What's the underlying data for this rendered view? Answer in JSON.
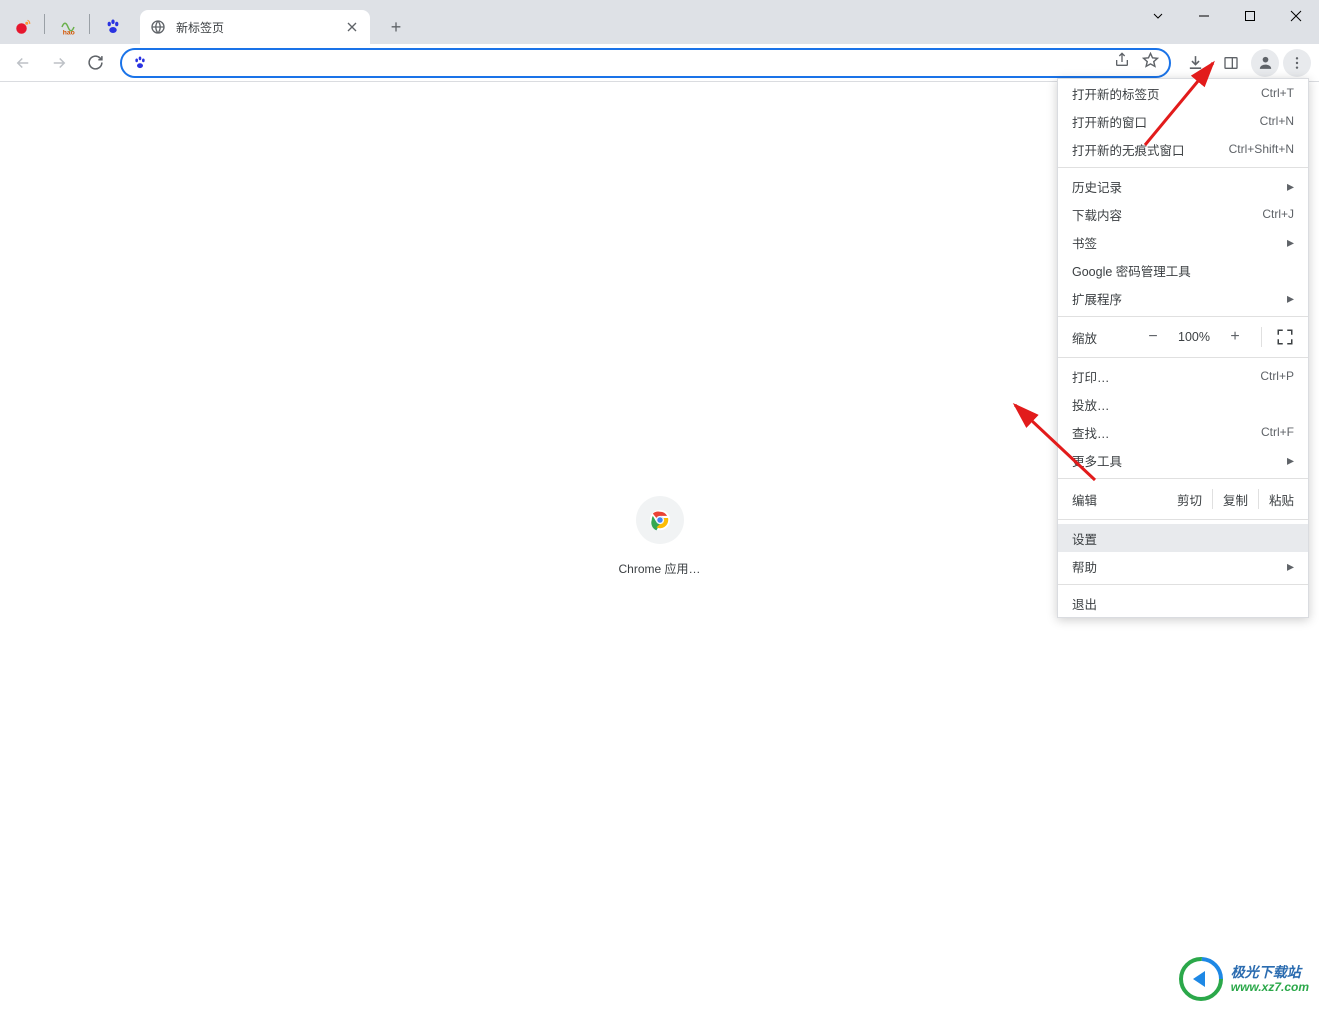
{
  "tab": {
    "title": "新标签页"
  },
  "content": {
    "shortcut_label": "Chrome 应用…"
  },
  "menu": {
    "new_tab": {
      "label": "打开新的标签页",
      "shortcut": "Ctrl+T"
    },
    "new_window": {
      "label": "打开新的窗口",
      "shortcut": "Ctrl+N"
    },
    "incognito": {
      "label": "打开新的无痕式窗口",
      "shortcut": "Ctrl+Shift+N"
    },
    "history": {
      "label": "历史记录"
    },
    "downloads": {
      "label": "下载内容",
      "shortcut": "Ctrl+J"
    },
    "bookmarks": {
      "label": "书签"
    },
    "passwords": {
      "label": "Google 密码管理工具"
    },
    "extensions": {
      "label": "扩展程序"
    },
    "zoom": {
      "label": "缩放",
      "value": "100%",
      "minus": "−",
      "plus": "+"
    },
    "print": {
      "label": "打印…",
      "shortcut": "Ctrl+P"
    },
    "cast": {
      "label": "投放…"
    },
    "find": {
      "label": "查找…",
      "shortcut": "Ctrl+F"
    },
    "more_tools": {
      "label": "更多工具"
    },
    "edit": {
      "label": "编辑",
      "cut": "剪切",
      "copy": "复制",
      "paste": "粘贴"
    },
    "settings": {
      "label": "设置"
    },
    "help": {
      "label": "帮助"
    },
    "exit": {
      "label": "退出"
    }
  },
  "watermark": {
    "title": "极光下载站",
    "url": "www.xz7.com"
  }
}
